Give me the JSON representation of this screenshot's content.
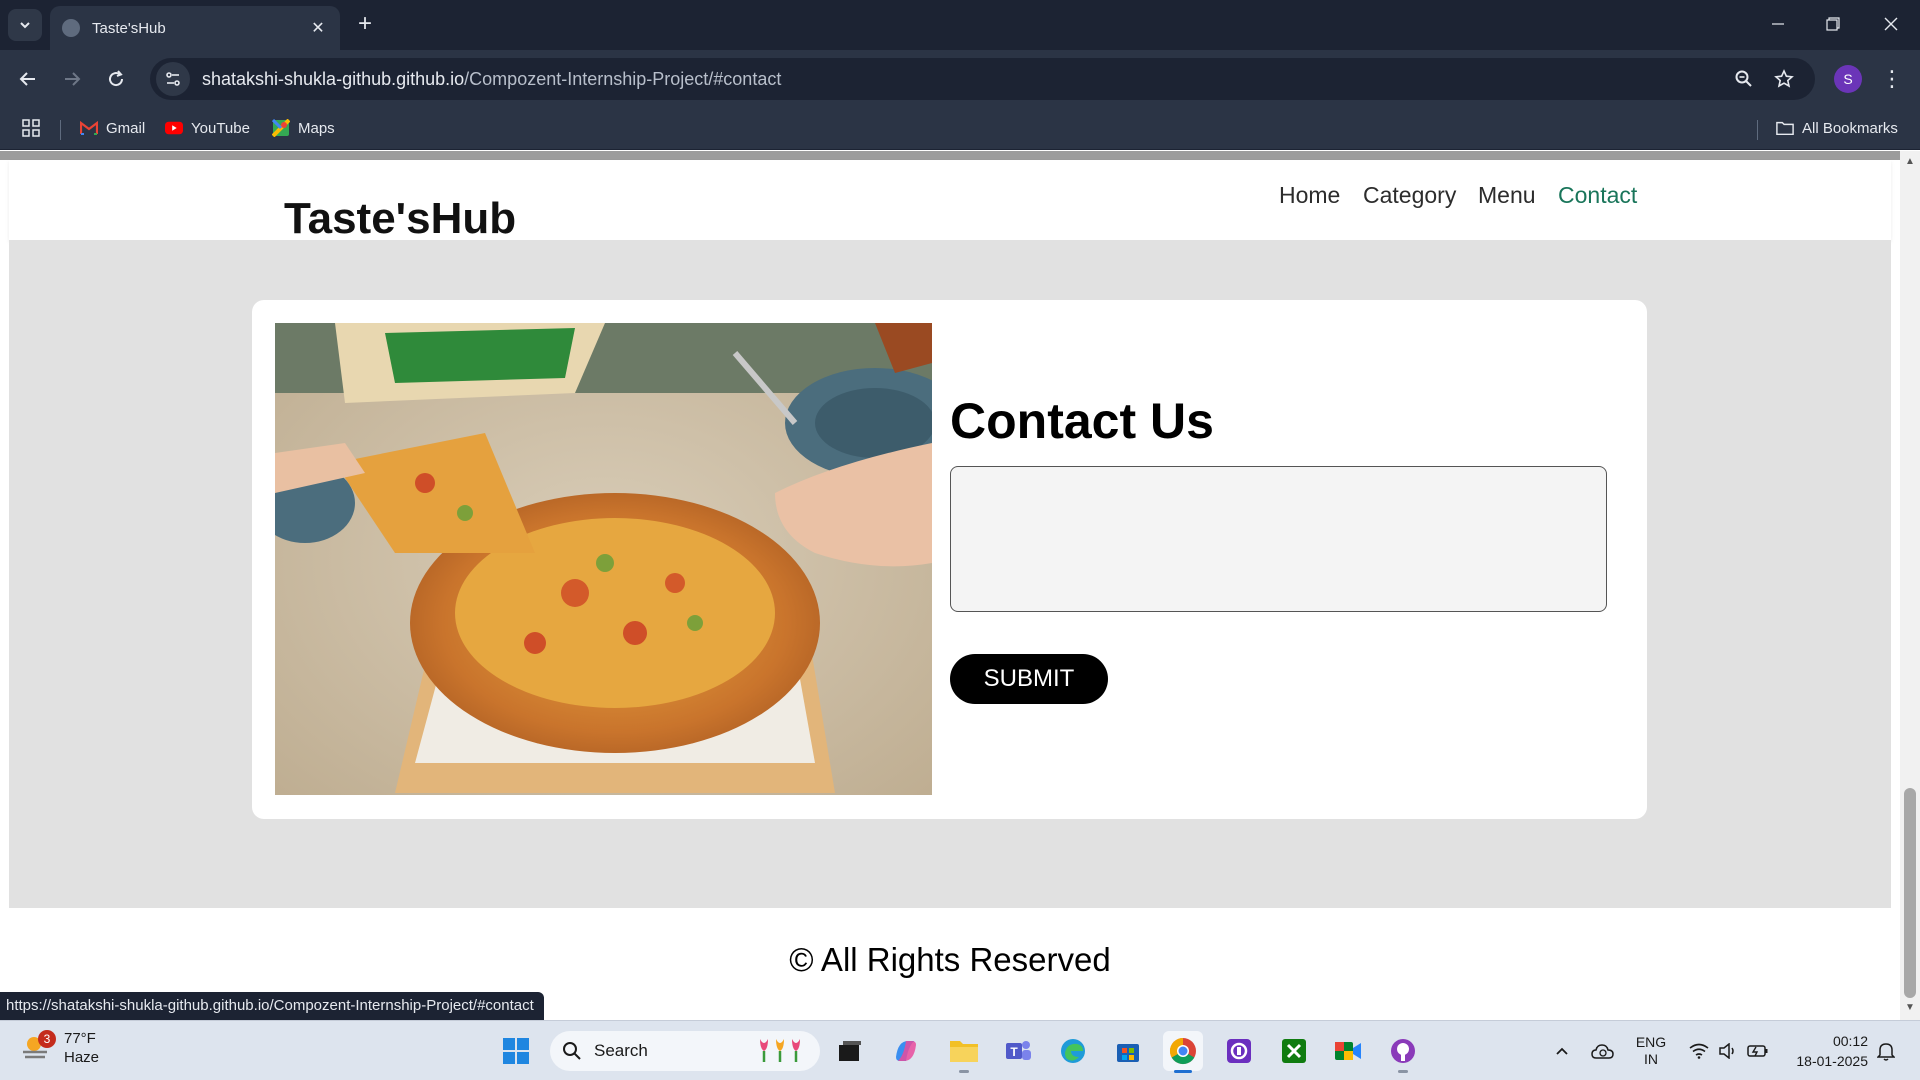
{
  "browser": {
    "tab_title": "Taste'sHub",
    "url_domain": "shatakshi-shukla-github.github.io",
    "url_path": "/Compozent-Internship-Project/#contact",
    "profile_initial": "S",
    "bookmarks": [
      {
        "label": "Gmail",
        "icon": "gmail-icon"
      },
      {
        "label": "YouTube",
        "icon": "youtube-icon"
      },
      {
        "label": "Maps",
        "icon": "maps-icon"
      }
    ],
    "all_bookmarks_label": "All Bookmarks",
    "status_url": "https://shatakshi-shukla-github.github.io/Compozent-Internship-Project/#contact"
  },
  "site": {
    "brand": "Taste'sHub",
    "nav": [
      {
        "label": "Home",
        "active": false
      },
      {
        "label": "Category",
        "active": false
      },
      {
        "label": "Menu",
        "active": false
      },
      {
        "label": "Contact",
        "active": true
      }
    ],
    "contact": {
      "title": "Contact Us",
      "message_value": "",
      "submit_label": "SUBMIT"
    },
    "footer": "© All Rights Reserved",
    "active_nav_color": "#19755a"
  },
  "taskbar": {
    "weather": {
      "temp": "77°F",
      "condition": "Haze",
      "badge": "3"
    },
    "search_placeholder": "Search",
    "language": {
      "line1": "ENG",
      "line2": "IN"
    },
    "time": "00:12",
    "date": "18-01-2025"
  }
}
